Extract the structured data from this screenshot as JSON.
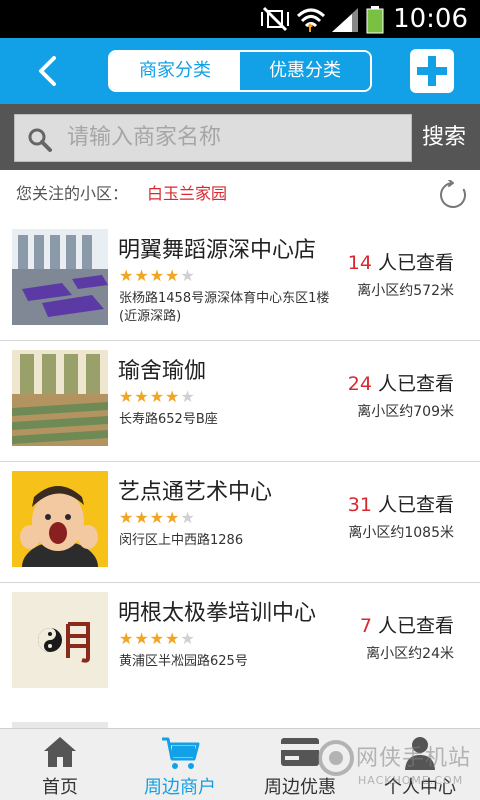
{
  "status_bar": {
    "time": "10:06"
  },
  "header": {
    "tabs": [
      {
        "label": "商家分类",
        "active": true
      },
      {
        "label": "优惠分类",
        "active": false
      }
    ]
  },
  "search": {
    "placeholder": "请输入商家名称",
    "button_label": "搜索"
  },
  "community": {
    "label": "您关注的小区：",
    "value": "白玉兰家园"
  },
  "merchants": [
    {
      "name": "明翼舞蹈源深中心店",
      "rating": 4,
      "address": "张杨路1458号源深体育中心东区1楼(近源深路)",
      "views": "14",
      "views_suffix": "人已查看",
      "distance": "离小区约572米"
    },
    {
      "name": "瑜舍瑜伽",
      "rating": 4,
      "address": "长寿路652号B座",
      "views": "24",
      "views_suffix": "人已查看",
      "distance": "离小区约709米"
    },
    {
      "name": "艺点通艺术中心",
      "rating": 4,
      "address": "闵行区上中西路1286",
      "views": "31",
      "views_suffix": "人已查看",
      "distance": "离小区约1085米"
    },
    {
      "name": "明根太极拳培训中心",
      "rating": 4,
      "address": "黄浦区半凇园路625号",
      "views": "7",
      "views_suffix": "人已查看",
      "distance": "离小区约24米"
    }
  ],
  "bottom_nav": [
    {
      "label": "首页",
      "icon": "home-icon",
      "active": false
    },
    {
      "label": "周边商户",
      "icon": "cart-icon",
      "active": true
    },
    {
      "label": "周边优惠",
      "icon": "card-icon",
      "active": false
    },
    {
      "label": "个人中心",
      "icon": "person-icon",
      "active": false
    }
  ],
  "watermark": {
    "text": "网侠手机站",
    "sub": "HACKHOME.COM"
  },
  "colors": {
    "accent": "#12a0e6",
    "highlight": "#d8282f",
    "star": "#f0a623",
    "search_bg": "#555555"
  }
}
